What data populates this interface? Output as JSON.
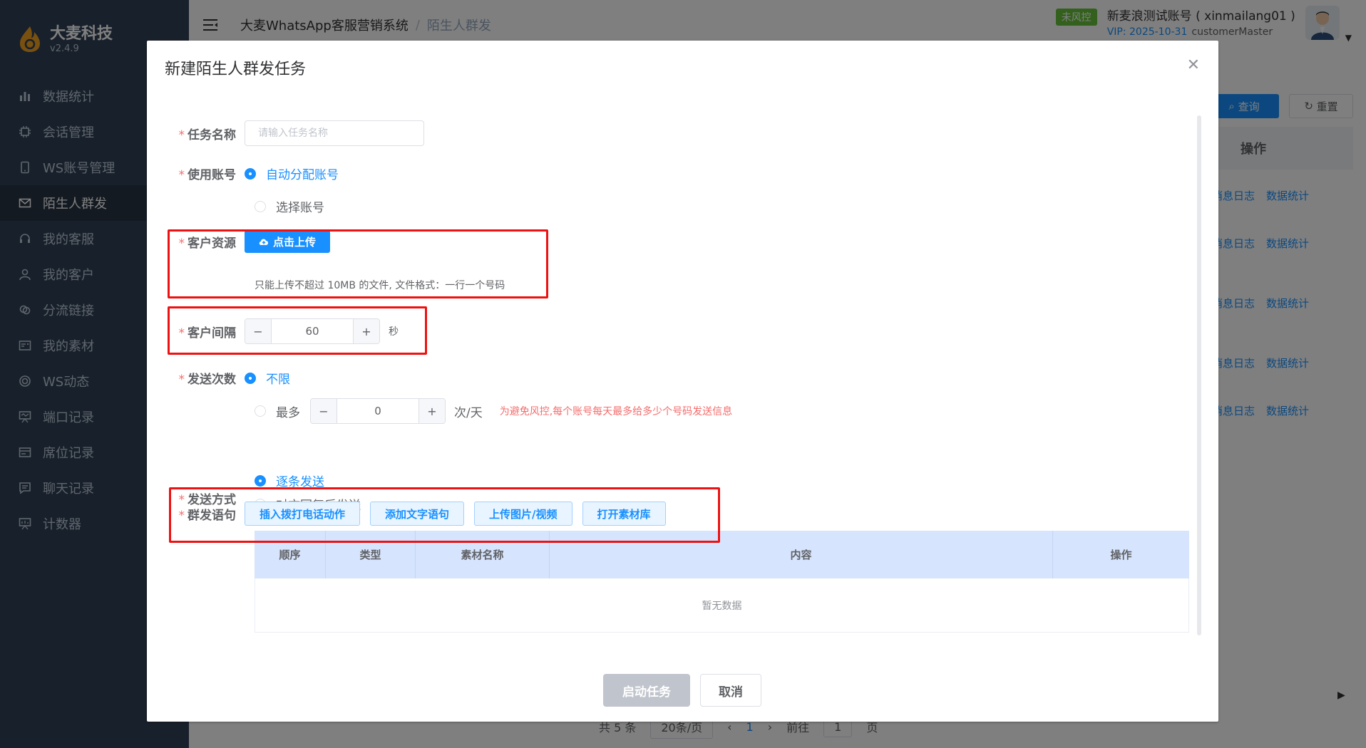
{
  "sidebar": {
    "brand": "大麦科技",
    "version": "v2.4.9",
    "items": [
      {
        "label": "数据统计",
        "icon": "bar-chart-icon"
      },
      {
        "label": "会话管理",
        "icon": "chip-icon"
      },
      {
        "label": "WS账号管理",
        "icon": "phone-icon"
      },
      {
        "label": "陌生人群发",
        "icon": "mail-icon"
      },
      {
        "label": "我的客服",
        "icon": "headset-icon"
      },
      {
        "label": "我的客户",
        "icon": "user-icon"
      },
      {
        "label": "分流链接",
        "icon": "link-icon"
      },
      {
        "label": "我的素材",
        "icon": "material-icon"
      },
      {
        "label": "WS动态",
        "icon": "circle-icon"
      },
      {
        "label": "端口记录",
        "icon": "board-icon"
      },
      {
        "label": "席位记录",
        "icon": "card-icon"
      },
      {
        "label": "聊天记录",
        "icon": "chat-icon"
      },
      {
        "label": "计数器",
        "icon": "counter-icon"
      }
    ]
  },
  "header": {
    "breadcrumb_root": "大麦WhatsApp客服营销系统",
    "breadcrumb_sep": "/",
    "breadcrumb_current": "陌生人群发",
    "risk_badge": "未风控",
    "account_name": "新麦浪测试账号 ( xinmailang01 )",
    "vip": "VIP: 2025-10-31",
    "role": "customerMaster"
  },
  "background": {
    "query": "查询",
    "reset": "重置",
    "column_ops": "操作",
    "row_links": [
      "消息日志",
      "数据统计"
    ],
    "pager_total": "共 5 条",
    "pager_size": "20条/页",
    "pager_page": "1",
    "pager_goto": "前往",
    "pager_goto_val": "1",
    "pager_page_unit": "页"
  },
  "dialog": {
    "title": "新建陌生人群发任务",
    "task_name": {
      "label": "任务名称",
      "placeholder": "请输入任务名称",
      "value": ""
    },
    "use_account": {
      "label": "使用账号",
      "options": [
        "自动分配账号",
        "选择账号"
      ],
      "selected": 0
    },
    "customer_source": {
      "label": "客户资源",
      "upload_label": "点击上传",
      "tip": "只能上传不超过 10MB 的文件, 文件格式：一行一个号码"
    },
    "customer_interval": {
      "label": "客户间隔",
      "value": "60",
      "unit": "秒"
    },
    "send_times": {
      "label": "发送次数",
      "opt_unlimited": "不限",
      "opt_max": "最多",
      "max_value": "0",
      "unit": "次/天",
      "warning": "为避免风控,每个账号每天最多给多少个号码发送信息"
    },
    "send_mode": {
      "label": "发送方式",
      "options": [
        "逐条发送",
        "对方回复后发送"
      ],
      "selected": 0
    },
    "group_message": {
      "label": "群发语句",
      "buttons": [
        "插入拨打电话动作",
        "添加文字语句",
        "上传图片/视频",
        "打开素材库"
      ],
      "columns": [
        "顺序",
        "类型",
        "素材名称",
        "内容",
        "操作"
      ],
      "empty": "暂无数据"
    },
    "start_button": "启动任务",
    "cancel_button": "取消"
  },
  "colors": {
    "primary": "#1890ff",
    "sidebar": "#304156",
    "danger": "#f56c6c",
    "success": "#67c23a"
  }
}
